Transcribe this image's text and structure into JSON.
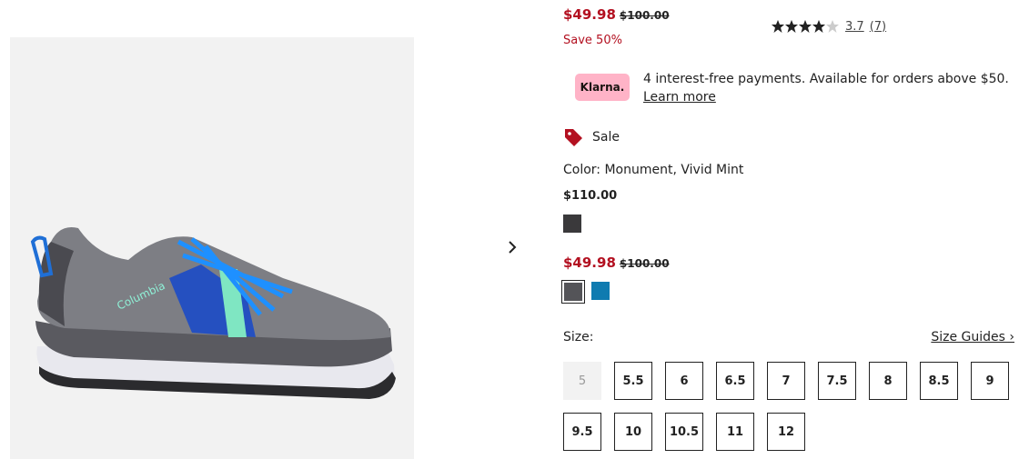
{
  "product": {
    "sale_price": "$49.98",
    "original_price": "$100.00",
    "save_text": "Save 50%",
    "rating_value": "3.7",
    "rating_count": "(7)",
    "rating_stars": 3.7,
    "sale_badge": "Sale",
    "color_label": "Color: Monument, Vivid Mint"
  },
  "klarna": {
    "badge": "Klarna.",
    "text": "4 interest-free payments. Available for orders above $50.",
    "link": "Learn more"
  },
  "color_groups": [
    {
      "price": "$110.00",
      "swatches": [
        {
          "name": "Dark Grey",
          "color": "#3a393b"
        }
      ]
    },
    {
      "sale_price": "$49.98",
      "original_price": "$100.00",
      "swatches": [
        {
          "name": "Monument",
          "color": "#545458",
          "selected": true
        },
        {
          "name": "Blue",
          "color": "#0f7bb0"
        }
      ]
    }
  ],
  "size": {
    "label": "Size:",
    "guides_link": "Size Guides ›",
    "options": [
      "5",
      "5.5",
      "6",
      "6.5",
      "7",
      "7.5",
      "8",
      "8.5",
      "9",
      "9.5",
      "10",
      "10.5",
      "11",
      "12"
    ],
    "unavailable": [
      "5"
    ]
  },
  "icons": {
    "next": "chevron-right-icon",
    "tag": "price-tag-icon",
    "star": "star-icon"
  },
  "colors": {
    "sale": "#b31020",
    "klarna": "#ffb3c7"
  }
}
